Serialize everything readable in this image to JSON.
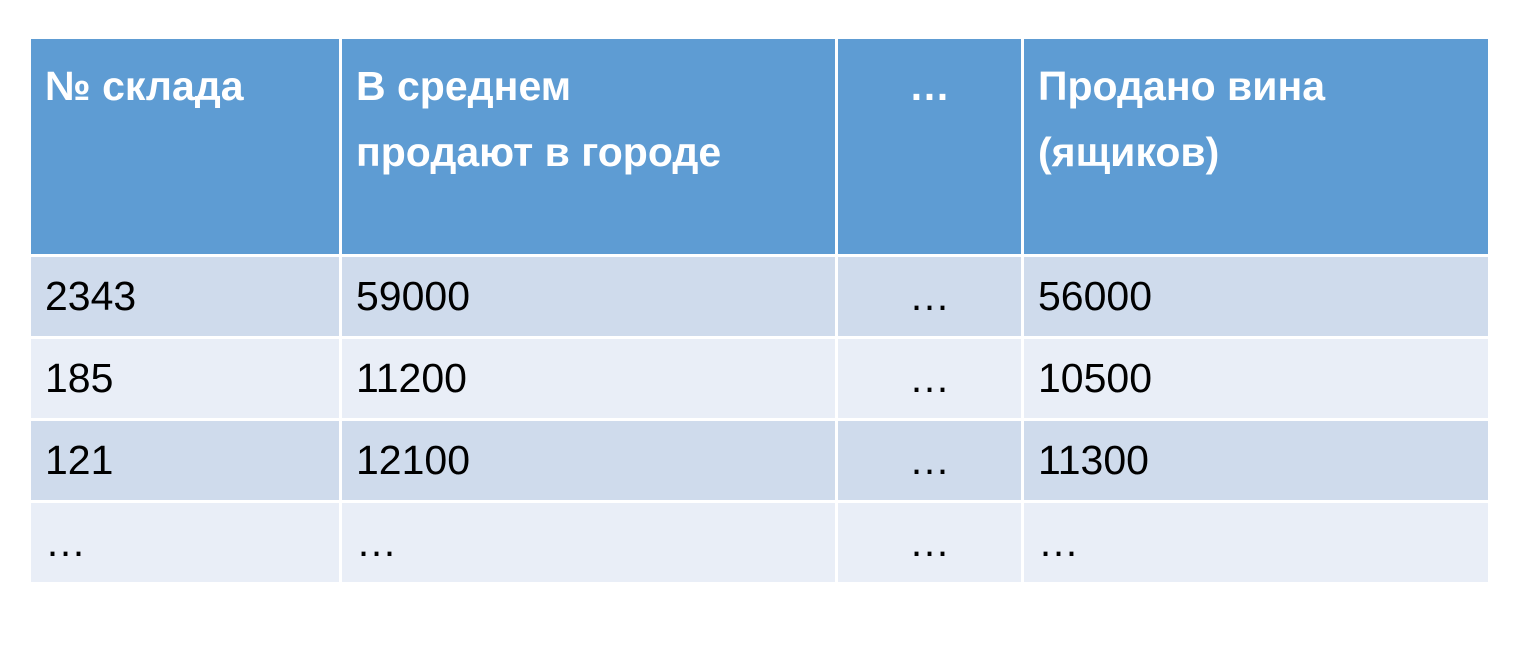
{
  "table": {
    "headers": [
      {
        "lines": [
          "№ склада"
        ]
      },
      {
        "lines": [
          "В среднем",
          "продают в городе"
        ]
      },
      {
        "lines": [
          "…"
        ]
      },
      {
        "lines": [
          "Продано вина",
          "(ящиков)"
        ]
      }
    ],
    "rows": [
      [
        "2343",
        "59000",
        "…",
        "56000"
      ],
      [
        "185",
        "11200",
        "…",
        "10500"
      ],
      [
        "121",
        "12100",
        "…",
        "11300"
      ],
      [
        "…",
        "…",
        "…",
        "…"
      ]
    ]
  },
  "colors": {
    "header_bg": "#5e9cd3",
    "row_odd_bg": "#cfdbec",
    "row_even_bg": "#e9eef7"
  }
}
